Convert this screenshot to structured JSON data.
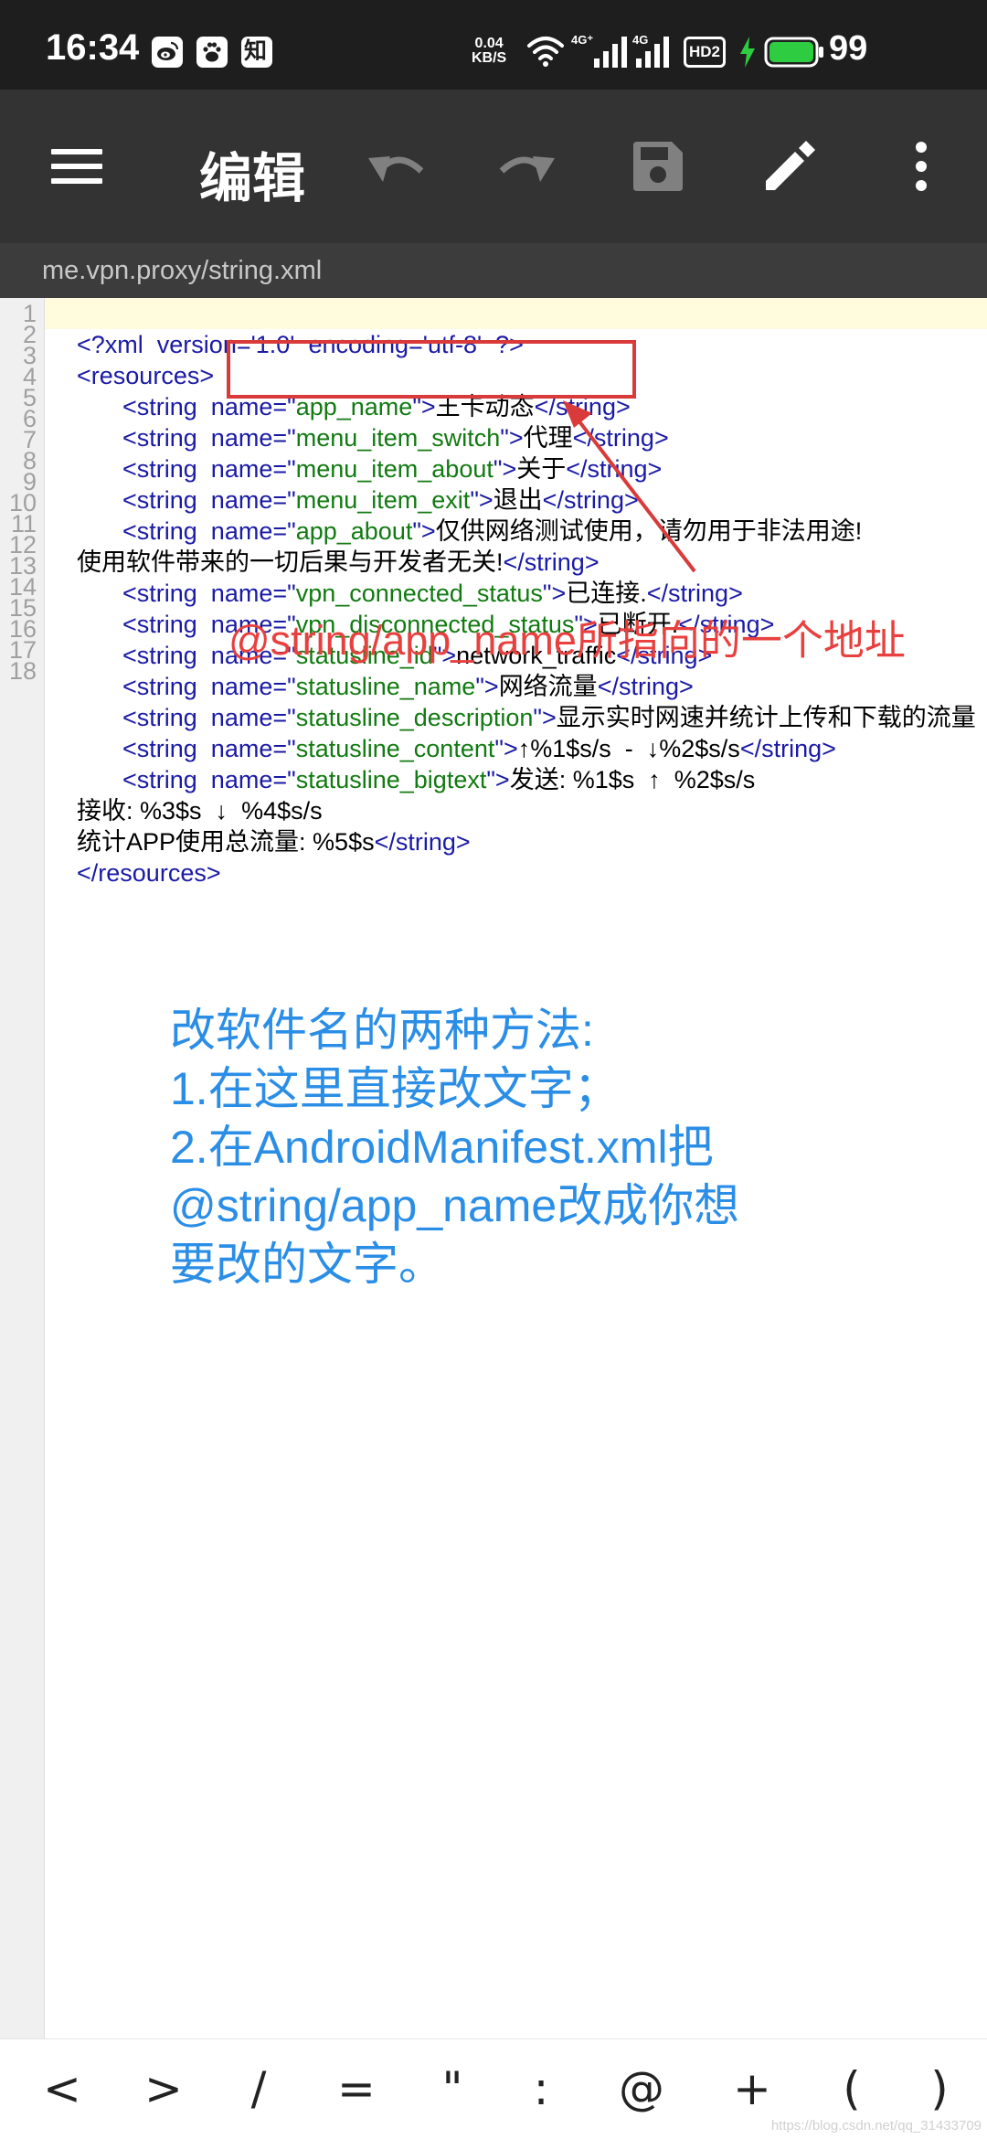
{
  "status_bar": {
    "time": "16:34",
    "net_speed_value": "0.04",
    "net_speed_unit": "KB/S",
    "battery_level": "99",
    "colors": {
      "background": "#1e1e1e",
      "battery_fill": "#2ecc40",
      "charging_bolt": "#2ecc40"
    },
    "icons": [
      "weibo-icon",
      "baidu-paw-icon",
      "zhihu-icon",
      "wifi-icon",
      "signal-4g-icon",
      "signal-4g-icon",
      "hd2-icon",
      "charging-icon",
      "battery-icon"
    ],
    "app_icons": {
      "zhihu_label": "知"
    },
    "signal_labels": {
      "sim1": "4G⁺",
      "sim2": "4G",
      "hd": "HD2"
    }
  },
  "toolbar": {
    "title": "编辑",
    "icons": [
      "menu-icon",
      "undo-icon",
      "redo-icon",
      "save-icon",
      "edit-pencil-icon",
      "more-vert-icon"
    ],
    "colors": {
      "background": "#333333",
      "active_icon": "#ffffff",
      "disabled_icon": "#808080"
    }
  },
  "path_bar": {
    "path": "me.vpn.proxy/string.xml"
  },
  "editor": {
    "line_numbers": [
      "1",
      "2",
      "3",
      "4",
      "5",
      "6",
      "7",
      "8",
      "9",
      "10",
      "11",
      "12",
      "13",
      "14",
      "15",
      "16",
      "17",
      "18"
    ],
    "lines": [
      {
        "num": "1",
        "tag1": "<?xml  version='1.0'  encoding='utf-8'  ?>"
      },
      {
        "num": "2",
        "tag1": "<resources>"
      },
      {
        "num": "3",
        "tag1": "<string  name=\"",
        "val": "app_name",
        "tag2": "\">",
        "text": "王卡动态",
        "tag3": "</string>"
      },
      {
        "num": "4",
        "tag1": "<string  name=\"",
        "val": "menu_item_switch",
        "tag2": "\">",
        "text": "代理",
        "tag3": "</string>"
      },
      {
        "num": "5",
        "tag1": "<string  name=\"",
        "val": "menu_item_about",
        "tag2": "\">",
        "text": "关于",
        "tag3": "</string>"
      },
      {
        "num": "6",
        "tag1": "<string  name=\"",
        "val": "menu_item_exit",
        "tag2": "\">",
        "text": "退出",
        "tag3": "</string>"
      },
      {
        "num": "7",
        "tag1": "<string  name=\"",
        "val": "app_about",
        "tag2": "\">",
        "text": "仅供网络测试使用，请勿用于非法用途!"
      },
      {
        "num": "8",
        "text": "使用软件带来的一切后果与开发者无关!",
        "tag3": "</string>"
      },
      {
        "num": "9",
        "tag1": "<string  name=\"",
        "val": "vpn_connected_status",
        "tag2": "\">",
        "text": "已连接.",
        "tag3": "</string>"
      },
      {
        "num": "10",
        "tag1": "<string  name=\"",
        "val": "vpn_disconnected_status",
        "tag2": "\">",
        "text": "已断开.",
        "tag3": "</string>"
      },
      {
        "num": "11",
        "tag1": "<string  name=\"",
        "val": "statusline_id",
        "tag2": "\">",
        "text": "network_traffic",
        "tag3": "</string>"
      },
      {
        "num": "12",
        "tag1": "<string  name=\"",
        "val": "statusline_name",
        "tag2": "\">",
        "text": "网络流量",
        "tag3": "</string>"
      },
      {
        "num": "13",
        "tag1": "<string  name=\"",
        "val": "statusline_description",
        "tag2": "\">",
        "text": "显示实时网速并统计上传和下载的流量"
      },
      {
        "num": "14",
        "tag1": "<string  name=\"",
        "val": "statusline_content",
        "tag2": "\">",
        "text": "↑%1$s/s  -  ↓%2$s/s",
        "tag3": "</string>"
      },
      {
        "num": "15",
        "tag1": "<string  name=\"",
        "val": "statusline_bigtext",
        "tag2": "\">",
        "text": "发送: %1$s  ↑  %2$s/s"
      },
      {
        "num": "16",
        "text": "接收: %3$s  ↓  %4$s/s"
      },
      {
        "num": "17",
        "text": "统计APP使用总流量: %5$s",
        "tag3": "</string>"
      },
      {
        "num": "18",
        "tag1": "</resources>"
      }
    ],
    "colors": {
      "tag": "#1a1aa6",
      "attr_value": "#117a11",
      "text": "#000000",
      "current_line": "#fffbdc",
      "line_number": "#a0a0a0"
    }
  },
  "annotations": {
    "pointer_note": "@string/app_name所指向的一个地址",
    "method_note": [
      "改软件名的两种方法:",
      "1.在这里直接改文字；",
      "2.在AndroidManifest.xml把",
      "@string/app_name改成你想",
      "要改的文字。"
    ],
    "colors": {
      "highlight_box": "#d93a3a",
      "arrow": "#d93a3a",
      "pointer_note": "#e8403e",
      "method_note": "#2b8ee6"
    }
  },
  "symbol_bar": {
    "keys": [
      "<",
      ">",
      "/",
      "=",
      "\"",
      ":",
      "@",
      "+",
      "(",
      ")"
    ]
  },
  "watermark": "https://blog.csdn.net/qq_31433709"
}
